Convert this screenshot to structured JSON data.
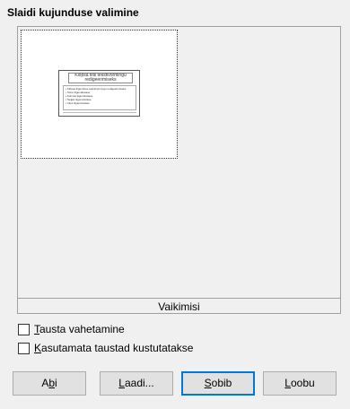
{
  "dialog": {
    "title": "Slaidi kujunduse valimine"
  },
  "preview": {
    "slide_title": "Klõpsa tiitli tekstivormingu redigeerimiseks",
    "slide_body_lines": [
      "• Klõpsa liigenduse tekstivormingu redigeerimiseks",
      "  • Teine liigendustase",
      "    • Kolmas liigendustase",
      "      • Neljas liigendustase",
      "        • Viies liigendustase"
    ],
    "caption": "Vaikimisi"
  },
  "options": {
    "exchange_background": {
      "label_ul": "T",
      "label_rest": "austa vahetamine",
      "checked": false
    },
    "delete_unused": {
      "label_ul": "K",
      "label_rest": "asutamata taustad kustutatakse",
      "checked": false
    }
  },
  "buttons": {
    "help": {
      "pre": "A",
      "ul": "b",
      "post": "i"
    },
    "load": {
      "pre": "",
      "ul": "L",
      "post": "aadi..."
    },
    "ok": {
      "pre": "",
      "ul": "S",
      "post": "obib"
    },
    "cancel": {
      "pre": "",
      "ul": "L",
      "post": "oobu"
    }
  }
}
